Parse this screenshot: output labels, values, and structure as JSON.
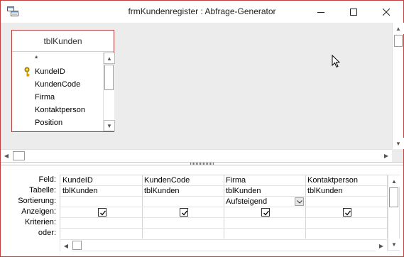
{
  "window": {
    "title": "frmKundenregister : Abfrage-Generator",
    "icons": {
      "app": "query-designer-icon",
      "minimize": "minimize-icon",
      "maximize": "maximize-icon",
      "close": "close-icon"
    }
  },
  "table_pane": {
    "table": {
      "name": "tblKunden",
      "fields": [
        {
          "label": "*",
          "primary_key": false
        },
        {
          "label": "KundeID",
          "primary_key": true
        },
        {
          "label": "KundenCode",
          "primary_key": false
        },
        {
          "label": "Firma",
          "primary_key": false
        },
        {
          "label": "Kontaktperson",
          "primary_key": false
        },
        {
          "label": "Position",
          "primary_key": false
        }
      ]
    }
  },
  "design_grid": {
    "row_labels": [
      "Feld:",
      "Tabelle:",
      "Sortierung:",
      "Anzeigen:",
      "Kriterien:",
      "oder:"
    ],
    "columns": [
      {
        "field": "KundeID",
        "table": "tblKunden",
        "sort": "",
        "show": true,
        "criteria": "",
        "or": ""
      },
      {
        "field": "KundenCode",
        "table": "tblKunden",
        "sort": "",
        "show": true,
        "criteria": "",
        "or": ""
      },
      {
        "field": "Firma",
        "table": "tblKunden",
        "sort": "Aufsteigend",
        "show": true,
        "criteria": "",
        "or": ""
      },
      {
        "field": "Kontaktperson",
        "table": "tblKunden",
        "sort": "",
        "show": true,
        "criteria": "",
        "or": ""
      }
    ]
  }
}
